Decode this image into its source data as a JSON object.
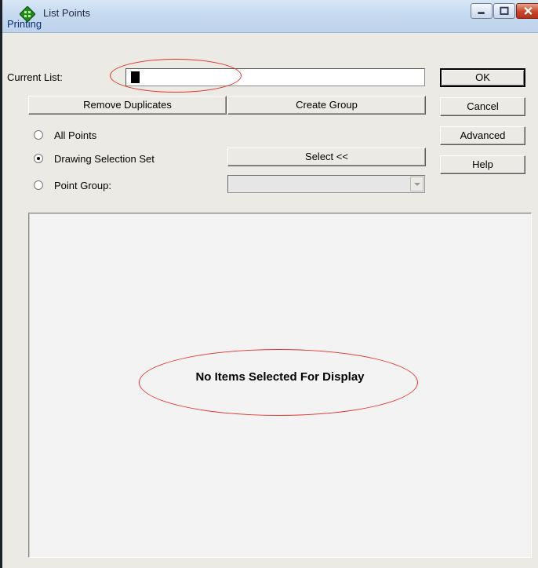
{
  "window": {
    "title": "List Points",
    "menu": [
      "Printing"
    ],
    "controls": {
      "minimize": "minimize-icon",
      "maximize": "maximize-icon",
      "close": "close-icon"
    }
  },
  "form": {
    "current_list_label": "Current List:",
    "current_list_value": "",
    "remove_duplicates": "Remove Duplicates",
    "create_group": "Create Group",
    "select_button": "Select <<",
    "point_group_value": ""
  },
  "radios": [
    {
      "label": "All Points",
      "checked": false
    },
    {
      "label": "Drawing Selection Set",
      "checked": true
    },
    {
      "label": "Point Group:",
      "checked": false
    }
  ],
  "side_buttons": {
    "ok": "OK",
    "cancel": "Cancel",
    "advanced": "Advanced",
    "help": "Help"
  },
  "list": {
    "empty_message": "No Items Selected For Display"
  },
  "colors": {
    "annotation": "#e8322a",
    "title_bar": "#c6d9ef",
    "menu_text": "#0a2a7a"
  }
}
